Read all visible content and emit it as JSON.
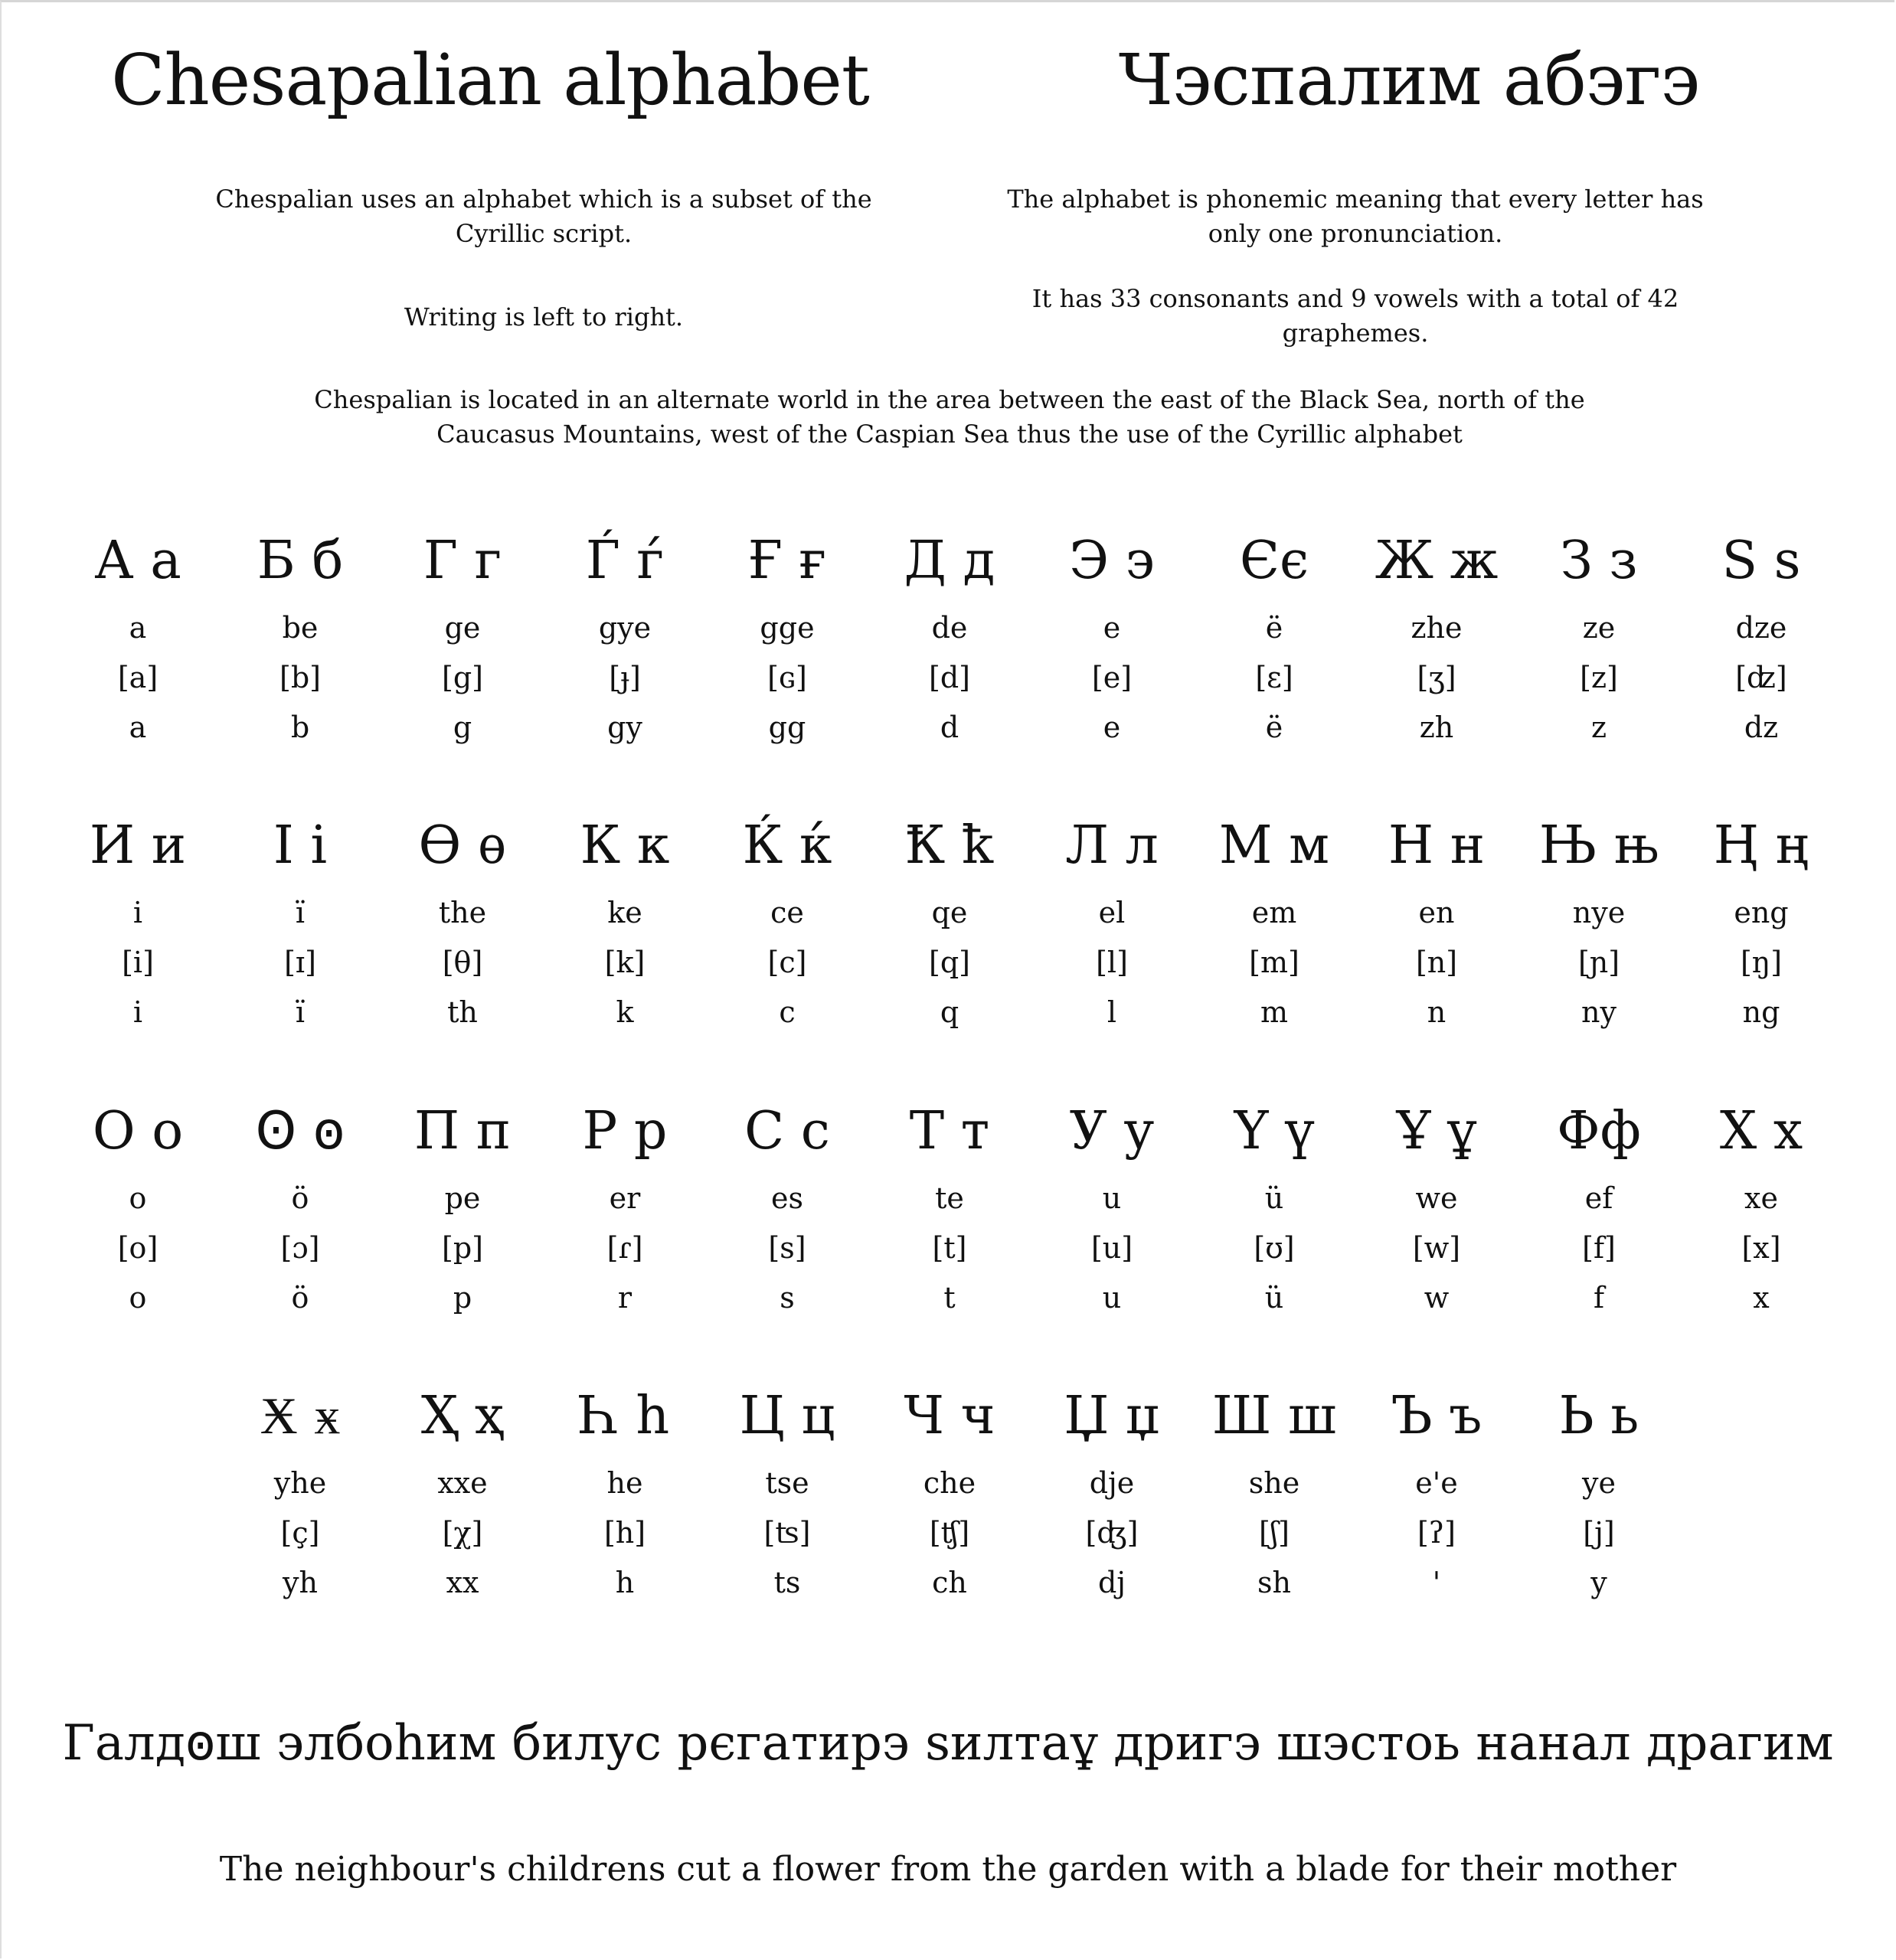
{
  "title_latin": "Chesapalian alphabet",
  "title_cyrillic": "Чэспалим абэгэ",
  "paragraphs": {
    "subset": "Chespalian uses an alphabet which is a subset of the Cyrillic script.",
    "direction": "Writing is left to right.",
    "phonemic": "The alphabet is phonemic meaning that every letter has only one pronunciation.",
    "counts": "It has 33 consonants and 9 vowels with a total of 42 graphemes.",
    "location": "Chespalian is located in an alternate world in the area between the east of the Black Sea, north of the Caucasus Mountains, west of the Caspian Sea thus the use of the Cyrillic alphabet"
  },
  "letters": [
    [
      {
        "glyph": "А а",
        "name": "a",
        "ipa": "[a]",
        "latin": "a"
      },
      {
        "glyph": "Б б",
        "name": "be",
        "ipa": "[b]",
        "latin": "b"
      },
      {
        "glyph": "Г г",
        "name": "ge",
        "ipa": "[g]",
        "latin": "g"
      },
      {
        "glyph": "Ѓ ѓ",
        "name": "gye",
        "ipa": "[ɟ]",
        "latin": "gy"
      },
      {
        "glyph": "Ғ ғ",
        "name": "gge",
        "ipa": "[ɢ]",
        "latin": "gg"
      },
      {
        "glyph": "Д д",
        "name": "de",
        "ipa": "[d]",
        "latin": "d"
      },
      {
        "glyph": "Э э",
        "name": "e",
        "ipa": "[e]",
        "latin": "e"
      },
      {
        "glyph": "Єє",
        "name": "ë",
        "ipa": "[ɛ]",
        "latin": "ë"
      },
      {
        "glyph": "Ж ж",
        "name": "zhe",
        "ipa": "[ʒ]",
        "latin": "zh"
      },
      {
        "glyph": "З з",
        "name": "ze",
        "ipa": "[z]",
        "latin": "z"
      },
      {
        "glyph": "Ѕ ѕ",
        "name": "dze",
        "ipa": "[ʣ]",
        "latin": "dz"
      }
    ],
    [
      {
        "glyph": "И и",
        "name": "i",
        "ipa": "[i]",
        "latin": "i"
      },
      {
        "glyph": "І і",
        "name": "ï",
        "ipa": "[ɪ]",
        "latin": "ï"
      },
      {
        "glyph": "Ѳ ѳ",
        "name": "the",
        "ipa": "[θ]",
        "latin": "th"
      },
      {
        "glyph": "К к",
        "name": "ke",
        "ipa": "[k]",
        "latin": "k"
      },
      {
        "glyph": "Ќ ќ",
        "name": "ce",
        "ipa": "[c]",
        "latin": "c"
      },
      {
        "glyph": "Ҟ ҟ",
        "name": "qe",
        "ipa": "[q]",
        "latin": "q"
      },
      {
        "glyph": "Л л",
        "name": "el",
        "ipa": "[l]",
        "latin": "l"
      },
      {
        "glyph": "М м",
        "name": "em",
        "ipa": "[m]",
        "latin": "m"
      },
      {
        "glyph": "Н н",
        "name": "en",
        "ipa": "[n]",
        "latin": "n"
      },
      {
        "glyph": "Њ њ",
        "name": "nye",
        "ipa": "[ɲ]",
        "latin": "ny"
      },
      {
        "glyph": "Ң ң",
        "name": "eng",
        "ipa": "[ŋ]",
        "latin": "ng"
      }
    ],
    [
      {
        "glyph": "О о",
        "name": "o",
        "ipa": "[o]",
        "latin": "o"
      },
      {
        "glyph": "Ꙩ ꙩ",
        "name": "ö",
        "ipa": "[ɔ]",
        "latin": "ö"
      },
      {
        "glyph": "П п",
        "name": "pe",
        "ipa": "[p]",
        "latin": "p"
      },
      {
        "glyph": "Р р",
        "name": "er",
        "ipa": "[ɾ]",
        "latin": "r"
      },
      {
        "glyph": "С с",
        "name": "es",
        "ipa": "[s]",
        "latin": "s"
      },
      {
        "glyph": "Т т",
        "name": "te",
        "ipa": "[t]",
        "latin": "t"
      },
      {
        "glyph": "У у",
        "name": "u",
        "ipa": "[u]",
        "latin": "u"
      },
      {
        "glyph": "Ү ү",
        "name": "ü",
        "ipa": "[ʊ]",
        "latin": "ü"
      },
      {
        "glyph": "Ұ ұ",
        "name": "we",
        "ipa": "[w]",
        "latin": "w"
      },
      {
        "glyph": "Фф",
        "name": "ef",
        "ipa": "[f]",
        "latin": "f"
      },
      {
        "glyph": "Х х",
        "name": "xe",
        "ipa": "[x]",
        "latin": "x"
      }
    ],
    [
      {
        "glyph": "Ӿ ӿ",
        "name": "yhe",
        "ipa": "[ç]",
        "latin": "yh"
      },
      {
        "glyph": "Ҳ ҳ",
        "name": "xxe",
        "ipa": "[χ]",
        "latin": "xx"
      },
      {
        "glyph": "Һ һ",
        "name": "he",
        "ipa": "[h]",
        "latin": "h"
      },
      {
        "glyph": "Ц ц",
        "name": "tse",
        "ipa": "[ʦ]",
        "latin": "ts"
      },
      {
        "glyph": "Ч ч",
        "name": "che",
        "ipa": "[ʧ]",
        "latin": "ch"
      },
      {
        "glyph": "Џ џ",
        "name": "dje",
        "ipa": "[ʤ]",
        "latin": "dj"
      },
      {
        "glyph": "Ш ш",
        "name": "she",
        "ipa": "[ʃ]",
        "latin": "sh"
      },
      {
        "glyph": "Ъ ъ",
        "name": "e'e",
        "ipa": "[ʔ]",
        "latin": "'"
      },
      {
        "glyph": "Ь ь",
        "name": "ye",
        "ipa": "[j]",
        "latin": "y"
      }
    ]
  ],
  "sample": {
    "cyrillic": "Галдꙩш элбоһим билус рєгатирэ ѕилтаұ дригэ шэстоь нанал драгим",
    "english": "The neighbour's childrens cut a flower from the garden with a blade for their mother"
  }
}
